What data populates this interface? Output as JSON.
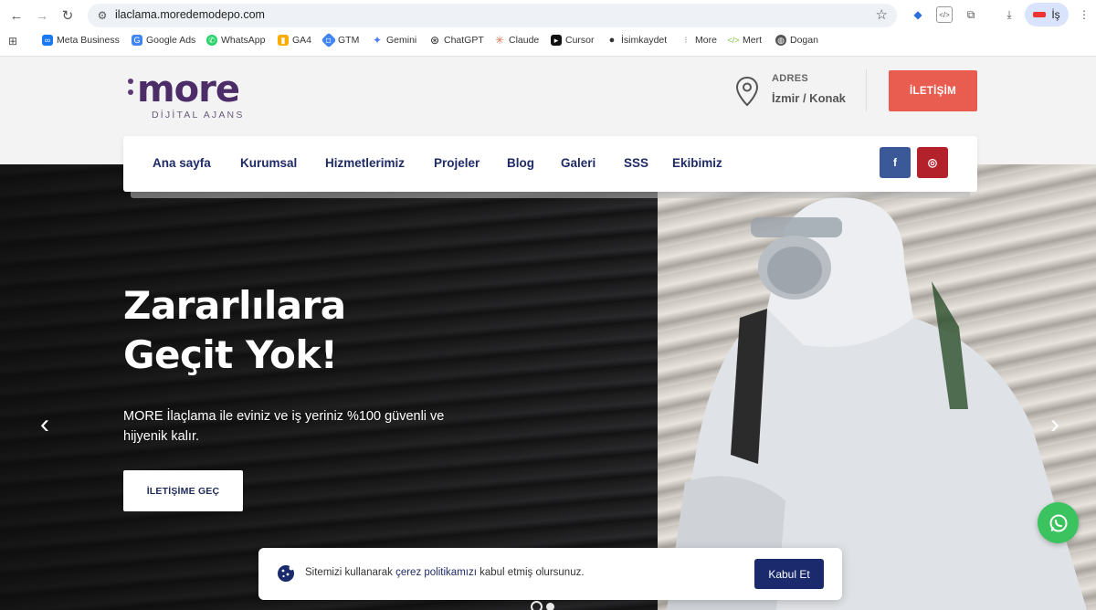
{
  "browser": {
    "url": "ilaclama.moredemodepo.com",
    "profile_label": "İş",
    "bookmarks": [
      {
        "label": "Meta Business",
        "icon": "meta-icon",
        "color": "#1877f2"
      },
      {
        "label": "Google Ads",
        "icon": "google-icon",
        "color": "#4285f4"
      },
      {
        "label": "WhatsApp",
        "icon": "whatsapp-icon",
        "color": "#25d366"
      },
      {
        "label": "GA4",
        "icon": "analytics-icon",
        "color": "#f9ab00"
      },
      {
        "label": "GTM",
        "icon": "gtm-icon",
        "color": "#4285f4"
      },
      {
        "label": "Gemini",
        "icon": "gemini-icon",
        "color": "#4f7ef7"
      },
      {
        "label": "ChatGPT",
        "icon": "chatgpt-icon",
        "color": "#222222"
      },
      {
        "label": "Claude",
        "icon": "claude-icon",
        "color": "#d97757"
      },
      {
        "label": "Cursor",
        "icon": "cursor-icon",
        "color": "#111111"
      },
      {
        "label": "İsimkaydet",
        "icon": "isimkaydet-icon",
        "color": "#333333"
      },
      {
        "label": "More",
        "icon": "more-icon",
        "color": "#888888"
      },
      {
        "label": "Mert",
        "icon": "code-icon",
        "color": "#7cc242"
      },
      {
        "label": "Dogan",
        "icon": "globe-icon",
        "color": "#555555"
      }
    ]
  },
  "header": {
    "logo_text": "more",
    "logo_sub": "DİJİTAL AJANS",
    "address_label": "ADRES",
    "address_value": "İzmir / Konak",
    "contact_button": "İLETİŞİM",
    "accent": "#e85d4f"
  },
  "nav": {
    "items": [
      "Ana sayfa",
      "Kurumsal",
      "Hizmetlerimiz",
      "Projeler",
      "Blog",
      "Galeri",
      "SSS",
      "Ekibimiz"
    ],
    "social": [
      {
        "name": "facebook",
        "label": "f",
        "color": "#3b5998"
      },
      {
        "name": "instagram",
        "label": "◎",
        "color": "#b3222a"
      }
    ]
  },
  "hero": {
    "title": "Zararlılara\nGeçit Yok!",
    "text": "MORE İlaçlama ile eviniz ve iş yeriniz %100 güvenli ve hijyenik kalır.",
    "button": "İLETİŞİME GEÇ"
  },
  "cookie": {
    "text_before": "Sitemizi kullanarak ",
    "link": "çerez politikamızı",
    "text_after": " kabul etmiş olursunuz.",
    "accept": "Kabul Et"
  }
}
